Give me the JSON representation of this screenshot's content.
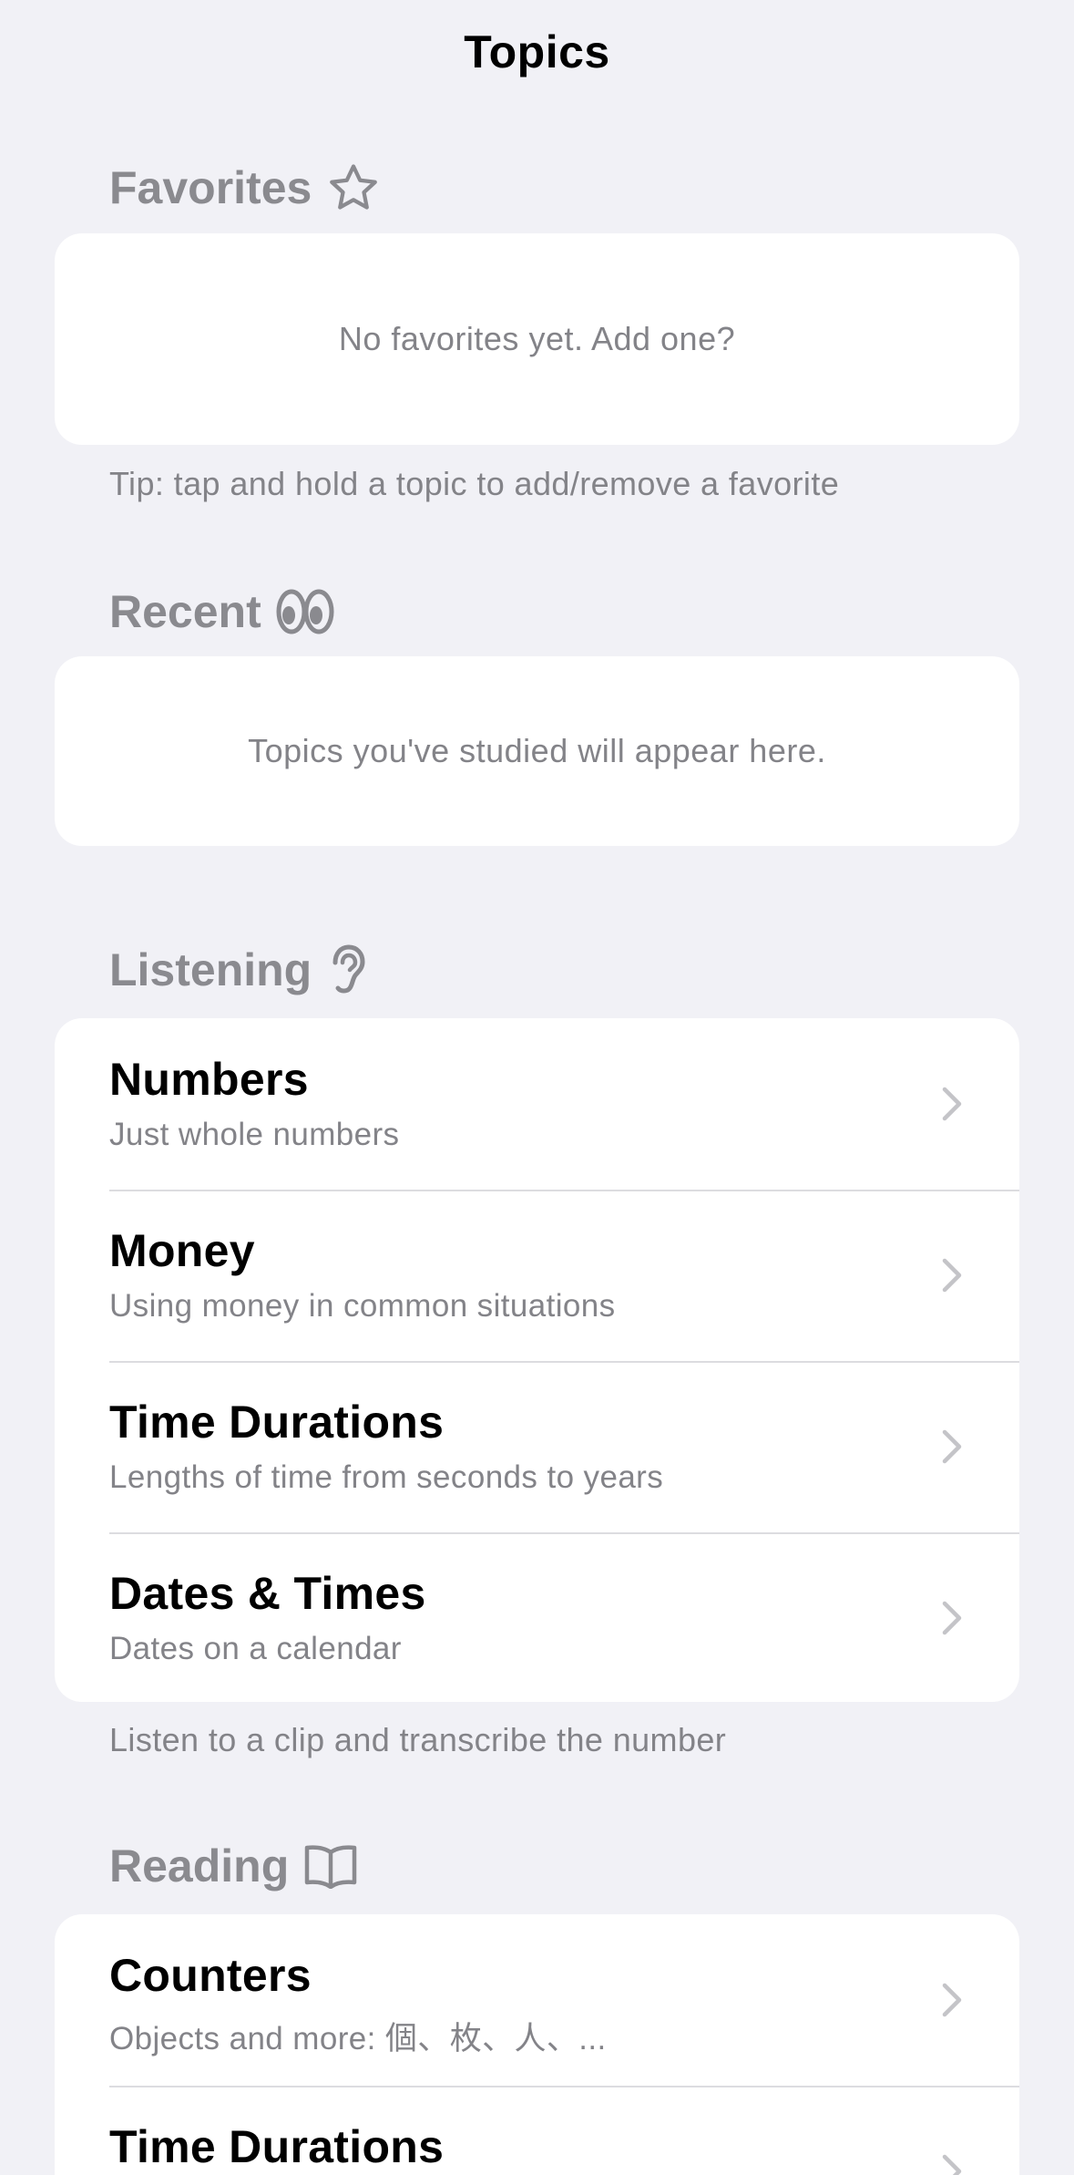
{
  "nav": {
    "title": "Topics"
  },
  "favorites": {
    "header": "Favorites",
    "icon": "star-icon",
    "empty_text": "No favorites yet. Add one?",
    "tip": "Tip: tap and hold a topic to add/remove a favorite"
  },
  "recent": {
    "header": "Recent",
    "icon": "eyes-icon",
    "empty_text": "Topics you've studied will appear here."
  },
  "listening": {
    "header": "Listening",
    "icon": "ear-icon",
    "items": [
      {
        "title": "Numbers",
        "subtitle": "Just whole numbers"
      },
      {
        "title": "Money",
        "subtitle": "Using money in common situations"
      },
      {
        "title": "Time Durations",
        "subtitle": "Lengths of time from seconds to years"
      },
      {
        "title": "Dates & Times",
        "subtitle": "Dates on a calendar"
      }
    ],
    "footer": "Listen to a clip and transcribe the number"
  },
  "reading": {
    "header": "Reading",
    "icon": "book-icon",
    "items": [
      {
        "title": "Counters",
        "subtitle": "Objects and more: 個、枚、人、..."
      },
      {
        "title": "Time Durations",
        "subtitle": ""
      }
    ]
  },
  "colors": {
    "background": "#f1f1f6",
    "card": "#ffffff",
    "secondary_text": "#838388",
    "header_text": "#8a8a8f",
    "chevron": "#c4c4c8"
  }
}
